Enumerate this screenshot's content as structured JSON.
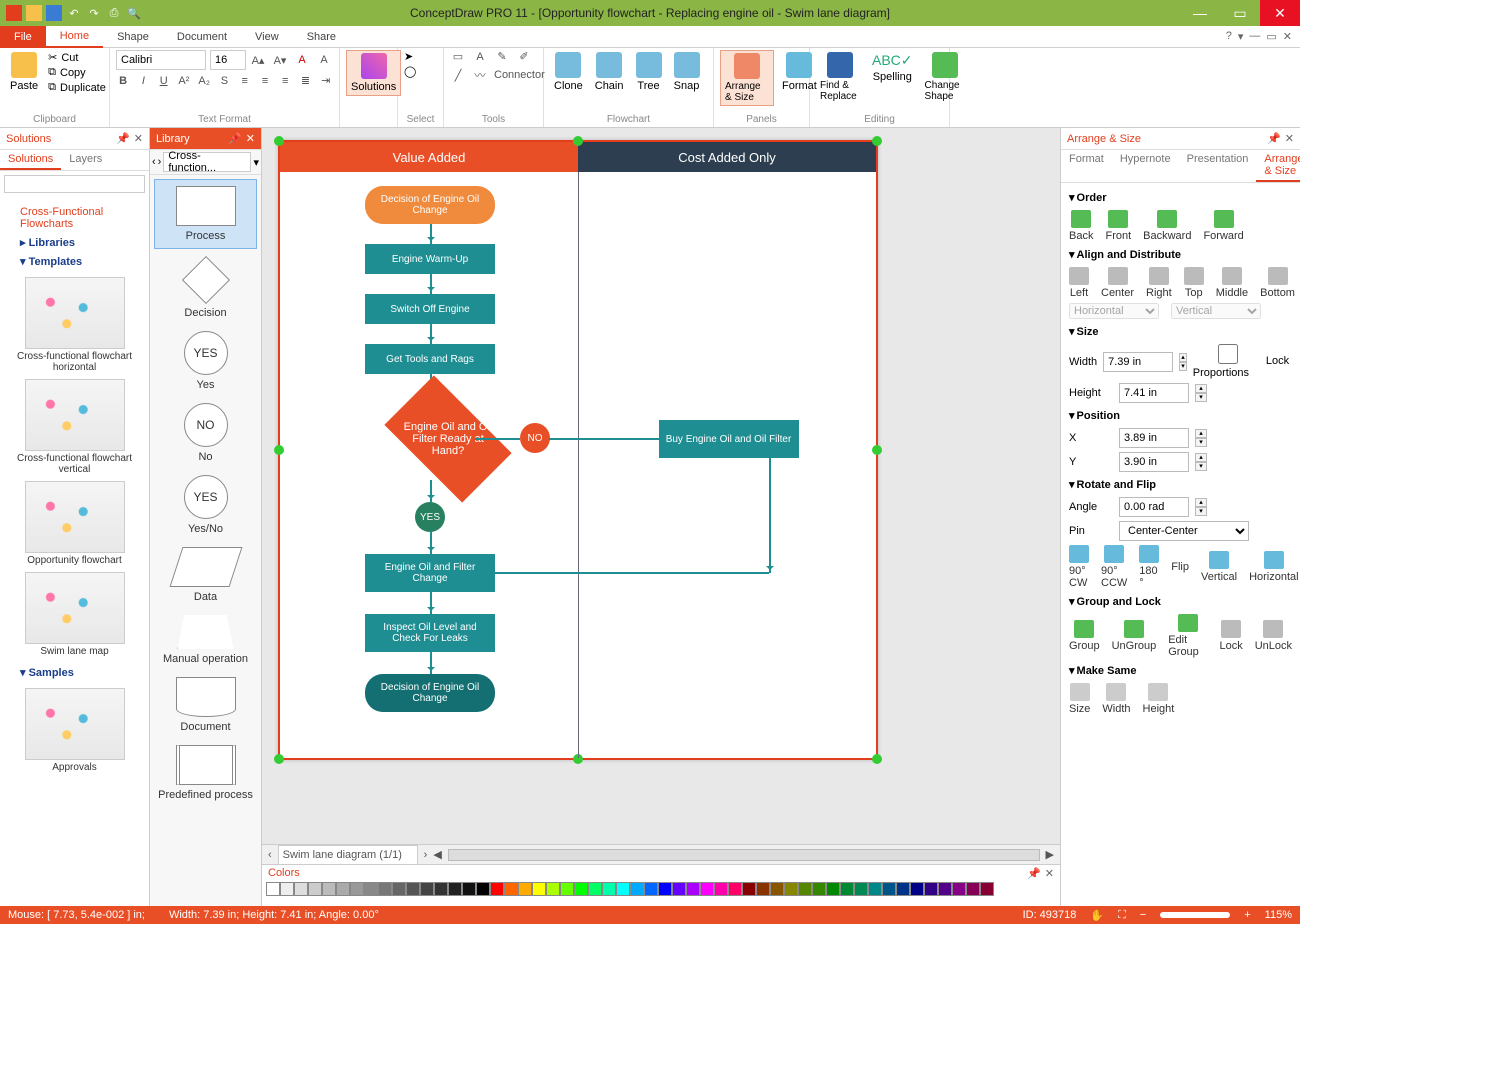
{
  "app": {
    "title": "ConceptDraw PRO 11 - [Opportunity flowchart - Replacing engine oil - Swim lane diagram]"
  },
  "menu": {
    "file": "File",
    "tabs": [
      "Home",
      "Shape",
      "Document",
      "View",
      "Share"
    ]
  },
  "ribbon": {
    "clipboard": {
      "paste": "Paste",
      "cut": "Cut",
      "copy": "Copy",
      "dup": "Duplicate",
      "label": "Clipboard"
    },
    "text": {
      "font": "Calibri",
      "size": "16",
      "label": "Text Format"
    },
    "solutions": {
      "btn": "Solutions",
      "label": ""
    },
    "select": {
      "label": "Select"
    },
    "tools": {
      "label": "Tools",
      "connector": "Connector"
    },
    "flowchart": {
      "clone": "Clone",
      "chain": "Chain",
      "tree": "Tree",
      "snap": "Snap",
      "label": "Flowchart"
    },
    "panels": {
      "arrange": "Arrange & Size",
      "format": "Format",
      "label": "Panels"
    },
    "editing": {
      "find": "Find & Replace",
      "spell": "Spelling",
      "change": "Change Shape",
      "label": "Editing"
    }
  },
  "solPanel": {
    "title": "Solutions",
    "tabs": [
      "Solutions",
      "Layers"
    ],
    "links": {
      "cff": "Cross-Functional Flowcharts",
      "libs": "Libraries",
      "tmpl": "Templates",
      "samples": "Samples"
    },
    "thumbs": [
      "Cross-functional flowchart horizontal",
      "Cross-functional flowchart vertical",
      "Opportunity flowchart",
      "Swim lane map",
      "Approvals"
    ]
  },
  "libPanel": {
    "title": "Library",
    "drop": "Cross-function...",
    "items": [
      "Process",
      "Decision",
      "Yes",
      "No",
      "Yes/No",
      "Data",
      "Manual operation",
      "Document",
      "Predefined process"
    ],
    "yes": "YES",
    "no": "NO"
  },
  "diagram": {
    "lanes": {
      "va": "Value Added",
      "ca": "Cost Added Only"
    },
    "n": {
      "start": "Decision of Engine Oil Change",
      "warm": "Engine Warm-Up",
      "off": "Switch Off Engine",
      "tools": "Get Tools and Rags",
      "dec": "Engine Oil and Oil Filter Ready at Hand?",
      "no": "NO",
      "yes": "YES",
      "buy": "Buy Engine Oil and Oil Filter",
      "change": "Engine Oil and Filter Change",
      "inspect": "Inspect Oil Level and Check For Leaks",
      "end": "Decision of Engine Oil Change"
    },
    "tab": "Swim lane diagram (1/1)"
  },
  "colors": {
    "title": "Colors"
  },
  "rp": {
    "title": "Arrange & Size",
    "tabs": [
      "Format",
      "Hypernote",
      "Presentation",
      "Arrange & Size"
    ],
    "order": {
      "h": "Order",
      "back": "Back",
      "front": "Front",
      "backward": "Backward",
      "forward": "Forward"
    },
    "align": {
      "h": "Align and Distribute",
      "left": "Left",
      "center": "Center",
      "right": "Right",
      "top": "Top",
      "middle": "Middle",
      "bottom": "Bottom",
      "horiz": "Horizontal",
      "vert": "Vertical"
    },
    "size": {
      "h": "Size",
      "w": "Width",
      "wv": "7.39 in",
      "ht": "Height",
      "hv": "7.41 in",
      "lock": "Lock Proportions"
    },
    "pos": {
      "h": "Position",
      "x": "X",
      "xv": "3.89 in",
      "y": "Y",
      "yv": "3.90 in"
    },
    "rot": {
      "h": "Rotate and Flip",
      "ang": "Angle",
      "av": "0.00 rad",
      "pin": "Pin",
      "pv": "Center-Center",
      "cw": "90° CW",
      "ccw": "90° CCW",
      "r180": "180 °",
      "flip": "Flip",
      "v": "Vertical",
      "ho": "Horizontal"
    },
    "grp": {
      "h": "Group and Lock",
      "g": "Group",
      "ug": "UnGroup",
      "eg": "Edit Group",
      "lk": "Lock",
      "ul": "UnLock"
    },
    "same": {
      "h": "Make Same",
      "s": "Size",
      "w": "Width",
      "hh": "Height"
    }
  },
  "status": {
    "mouse": "Mouse: [ 7.73, 5.4e-002 ] in;",
    "dims": "Width: 7.39 in;  Height: 7.41 in;  Angle: 0.00°",
    "id": "ID: 493718",
    "zoom": "115%"
  }
}
